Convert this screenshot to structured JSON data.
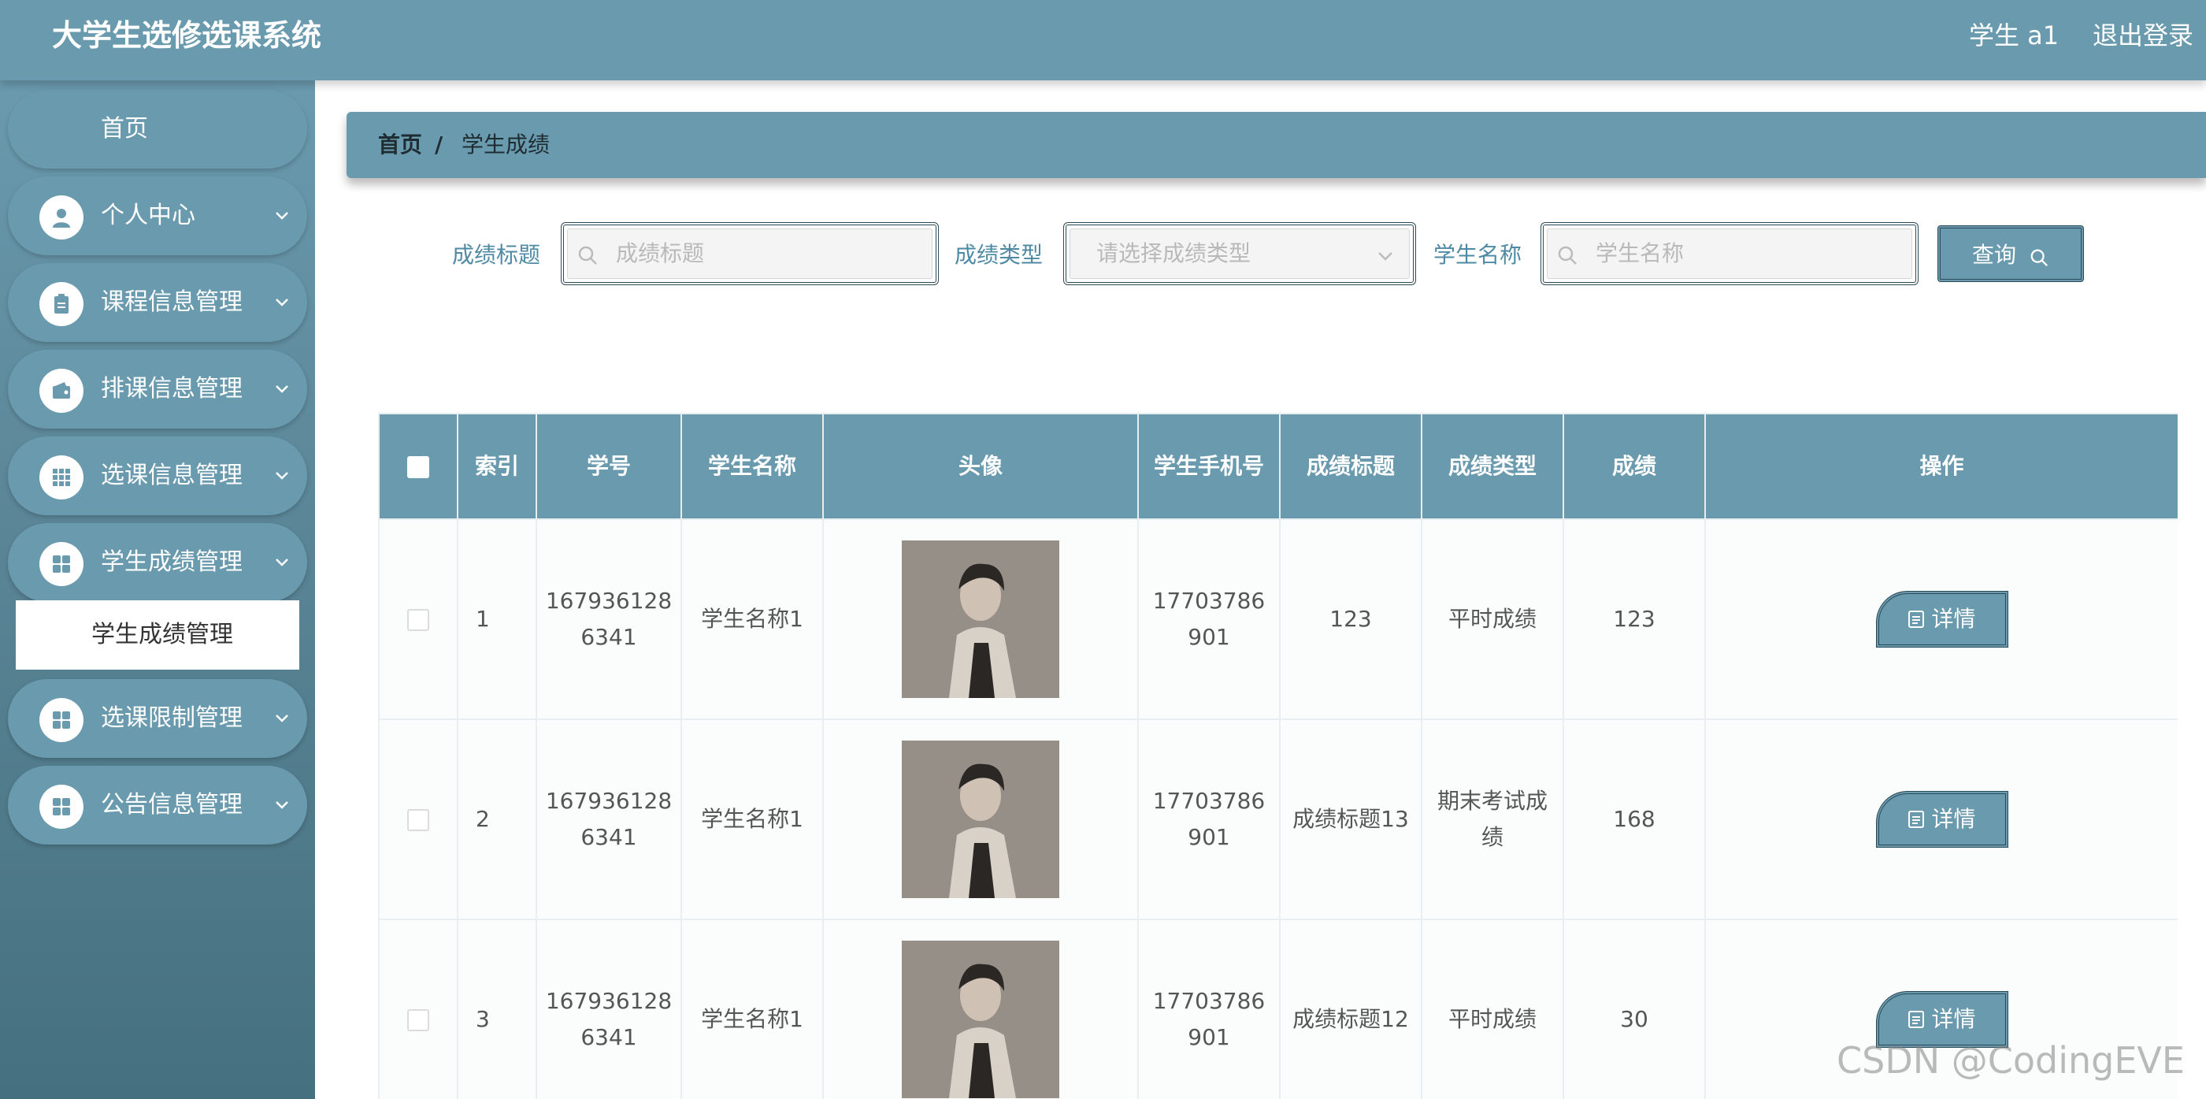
{
  "header": {
    "title": "大学生选修选课系统",
    "user": "学生 a1",
    "logout": "退出登录"
  },
  "sidebar": {
    "home": "首页",
    "items": [
      {
        "label": "个人中心",
        "icon": "user-icon"
      },
      {
        "label": "课程信息管理",
        "icon": "clipboard-icon"
      },
      {
        "label": "排课信息管理",
        "icon": "wallet-icon"
      },
      {
        "label": "选课信息管理",
        "icon": "grid-icon"
      },
      {
        "label": "学生成绩管理",
        "icon": "apps-icon"
      },
      {
        "label": "选课限制管理",
        "icon": "apps-icon"
      },
      {
        "label": "公告信息管理",
        "icon": "apps-icon"
      }
    ],
    "submenu_active": "学生成绩管理"
  },
  "breadcrumb": {
    "home": "首页",
    "separator": "/",
    "current": "学生成绩"
  },
  "filters": {
    "title_label": "成绩标题",
    "title_placeholder": "成绩标题",
    "type_label": "成绩类型",
    "type_placeholder": "请选择成绩类型",
    "student_label": "学生名称",
    "student_placeholder": "学生名称",
    "query_button": "查询"
  },
  "table": {
    "columns": [
      "索引",
      "学号",
      "学生名称",
      "头像",
      "学生手机号",
      "成绩标题",
      "成绩类型",
      "成绩",
      "操作"
    ],
    "detail_label": "详情",
    "rows": [
      {
        "index": "1",
        "student_id": "1679361286341",
        "name": "学生名称1",
        "phone": "17703786901",
        "title": "123",
        "type": "平时成绩",
        "score": "123"
      },
      {
        "index": "2",
        "student_id": "1679361286341",
        "name": "学生名称1",
        "phone": "17703786901",
        "title": "成绩标题13",
        "type": "期末考试成绩",
        "score": "168"
      },
      {
        "index": "3",
        "student_id": "1679361286341",
        "name": "学生名称1",
        "phone": "17703786901",
        "title": "成绩标题12",
        "type": "平时成绩",
        "score": "30"
      }
    ]
  },
  "watermark": "CSDN @CodingEVE",
  "colors": {
    "primary": "#6a9aae",
    "border_dark": "#2c4a57",
    "label_blue": "#4f8aa5"
  }
}
